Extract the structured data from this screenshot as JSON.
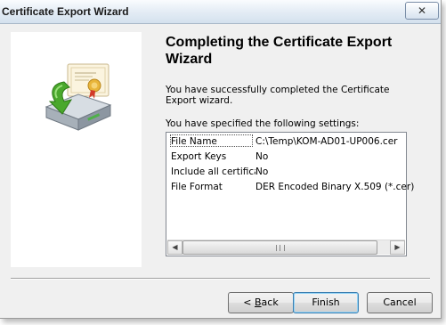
{
  "window": {
    "title": "Certificate Export Wizard",
    "close_glyph": "✕"
  },
  "heading": "Completing the Certificate Export Wizard",
  "message": "You have successfully completed the Certificate Export wizard.",
  "settings_label": "You have specified the following settings:",
  "settings": [
    {
      "name": "File Name",
      "value": "C:\\Temp\\KOM-AD01-UP006.cer"
    },
    {
      "name": "Export Keys",
      "value": "No"
    },
    {
      "name": "Include all certifica",
      "value": "No"
    },
    {
      "name": "File Format",
      "value": "DER Encoded Binary X.509 (*.cer)"
    }
  ],
  "scrollbar": {
    "left_arrow": "◀",
    "right_arrow": "▶"
  },
  "buttons": {
    "back_prefix": "< ",
    "back_mnemonic": "B",
    "back_rest": "ack",
    "finish": "Finish",
    "cancel": "Cancel"
  },
  "icons": {
    "wizard": "certificate-export-disk-icon",
    "close": "close-icon"
  },
  "colors": {
    "titlebar_top": "#fafcfe",
    "titlebar_bottom": "#d4e1ee",
    "dialog_bg": "#f0f0f0",
    "default_button_border": "#3c7fb1",
    "arrow_green": "#4aa82c"
  }
}
